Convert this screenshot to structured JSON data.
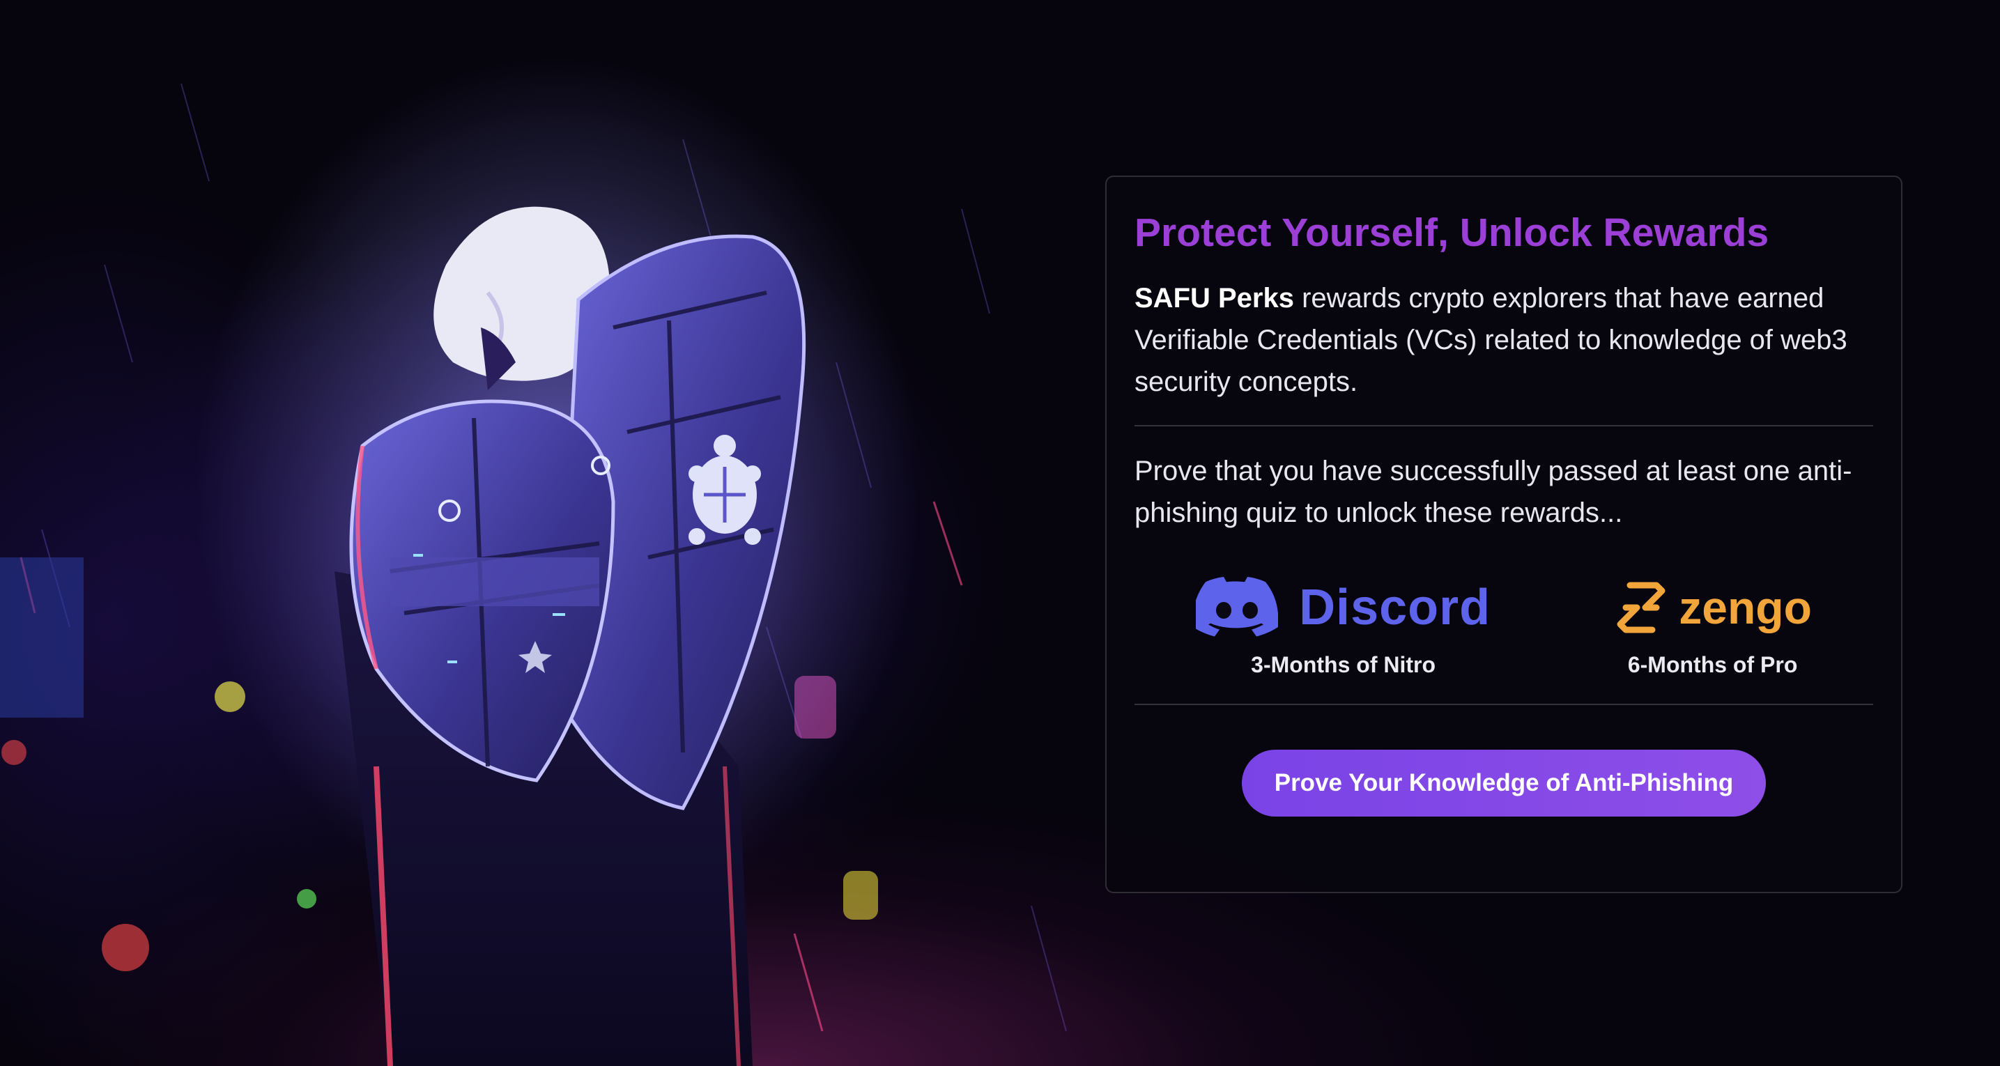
{
  "card": {
    "title": "Protect Yourself, Unlock Rewards",
    "intro_brand": "SAFU Perks",
    "intro_text": " rewards crypto explorers that have earned Verifiable Credentials (VCs) related to knowledge of web3 security concepts.",
    "prove_text": "Prove that you have successfully passed at least one anti-phishing quiz to unlock these rewards...",
    "rewards": [
      {
        "brand": "Discord",
        "icon": "discord-logo-icon",
        "label": "3-Months of Nitro",
        "color": "#5d63ea"
      },
      {
        "brand": "zengo",
        "icon": "zengo-logo-icon",
        "label": "6-Months of Pro",
        "color": "#f2a53a"
      }
    ],
    "cta_label": "Prove Your Knowledge of Anti-Phishing"
  },
  "theme": {
    "title_color": "#9b3fd6",
    "button_color": "#7a43e6",
    "background": "#06040d"
  }
}
